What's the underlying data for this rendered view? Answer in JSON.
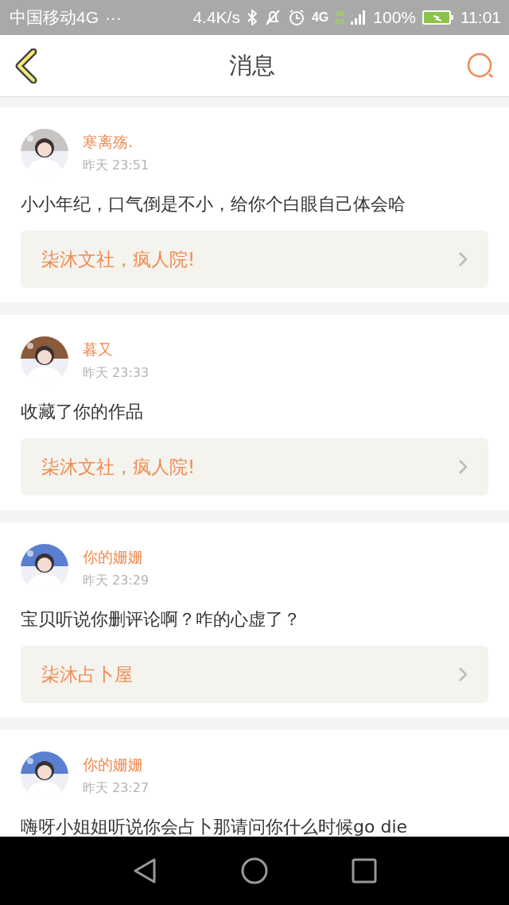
{
  "status_bar": {
    "carrier": "中国移动4G",
    "more": "···",
    "speed": "4.4K/s",
    "network": "4G",
    "sim_labels": [
      "4G",
      "2G"
    ],
    "battery": "100%",
    "time": "11:01"
  },
  "header": {
    "title": "消息"
  },
  "messages": [
    {
      "user": "寒离殇.",
      "time": "昨天 23:51",
      "text": "小小年纪，口气倒是不小，给你个白眼自己体会哈",
      "link": "柒沐文社，疯人院!"
    },
    {
      "user": "暮又",
      "time": "昨天 23:33",
      "text": "收藏了你的作品",
      "link": "柒沐文社，疯人院!"
    },
    {
      "user": "你的姗姗",
      "time": "昨天 23:29",
      "text": "宝贝听说你删评论啊？咋的心虚了？",
      "link": "柒沐占卜屋"
    },
    {
      "user": "你的姗姗",
      "time": "昨天 23:27",
      "text": "嗨呀小姐姐听说你会占卜那请问你什么时候go die"
    }
  ]
}
